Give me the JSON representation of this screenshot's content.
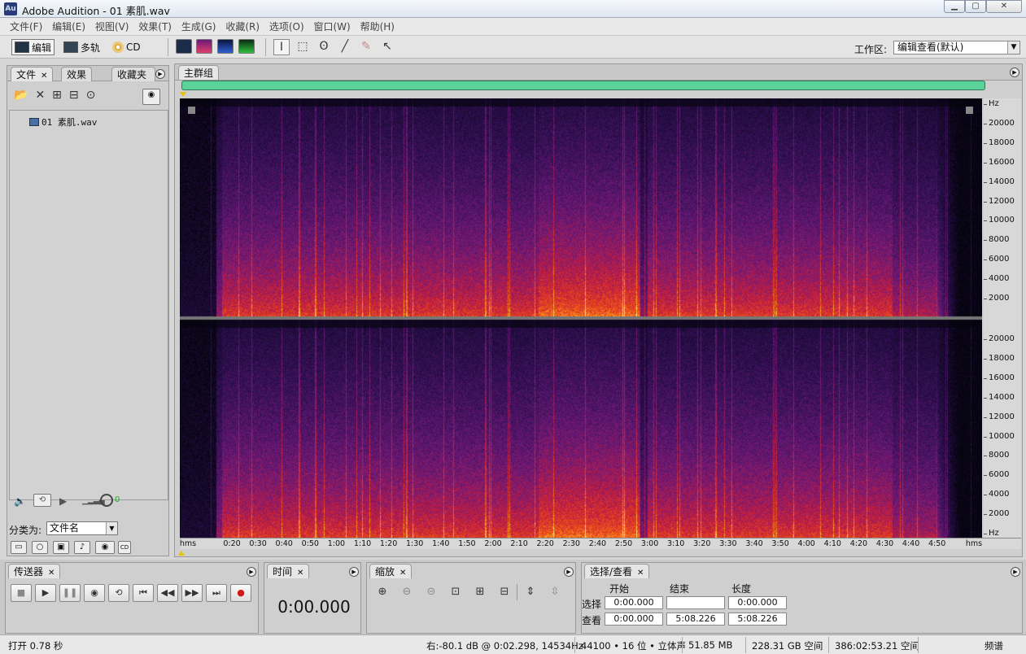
{
  "window": {
    "title": "Adobe Audition - 01 素肌.wav",
    "icon_text": "Au",
    "min": "▁",
    "max": "▢",
    "close": "✕"
  },
  "menu": [
    "文件(F)",
    "编辑(E)",
    "视图(V)",
    "效果(T)",
    "生成(G)",
    "收藏(R)",
    "选项(O)",
    "窗口(W)",
    "帮助(H)"
  ],
  "toolbar": {
    "edit_label": "编辑",
    "multitrack_label": "多轨",
    "cd_label": "CD",
    "workspace_label": "工作区:",
    "workspace_value": "编辑查看(默认)"
  },
  "files_panel": {
    "tabs": [
      "文件",
      "效果",
      "收藏夹"
    ],
    "files": [
      "01 素肌.wav"
    ],
    "sort_label": "分类为:",
    "sort_value": "文件名"
  },
  "editor": {
    "tab": "主群组",
    "freq_ticks_top": [
      "Hz",
      "20000",
      "18000",
      "16000",
      "14000",
      "12000",
      "10000",
      "8000",
      "6000",
      "4000",
      "2000"
    ],
    "freq_ticks_bottom": [
      "20000",
      "18000",
      "16000",
      "14000",
      "12000",
      "10000",
      "8000",
      "6000",
      "4000",
      "2000",
      "Hz"
    ],
    "time_ticks": [
      "hms",
      "0:20",
      "0:30",
      "0:40",
      "0:50",
      "1:00",
      "1:10",
      "1:20",
      "1:30",
      "1:40",
      "1:50",
      "2:00",
      "2:10",
      "2:20",
      "2:30",
      "2:40",
      "2:50",
      "3:00",
      "3:10",
      "3:20",
      "3:30",
      "3:40",
      "3:50",
      "4:00",
      "4:10",
      "4:20",
      "4:30",
      "4:40",
      "4:50",
      "hms"
    ]
  },
  "transport": {
    "tab": "传送器"
  },
  "time": {
    "tab": "时间",
    "value": "0:00.000"
  },
  "zoom": {
    "tab": "缩放"
  },
  "selection": {
    "tab": "选择/查看",
    "col_start": "开始",
    "col_end": "结束",
    "col_length": "长度",
    "row_select": "选择",
    "row_view": "查看",
    "select_start": "0:00.000",
    "select_end": "",
    "select_length": "0:00.000",
    "view_start": "0:00.000",
    "view_end": "5:08.226",
    "view_length": "5:08.226"
  },
  "status": {
    "open_time": "打开 0.78 秒",
    "cursor": "右:-80.1 dB @   0:02.298, 14534Hz",
    "format": "44100 • 16 位 • 立体声",
    "size": "51.85 MB",
    "free_space": "228.31 GB 空间",
    "free_time": "386:02:53.21 空间",
    "view_mode": "频谱"
  },
  "colors": {
    "overview": "#5ad29a",
    "spectro_low": "#1a0a2e",
    "spectro_high": "#ffd94a"
  }
}
